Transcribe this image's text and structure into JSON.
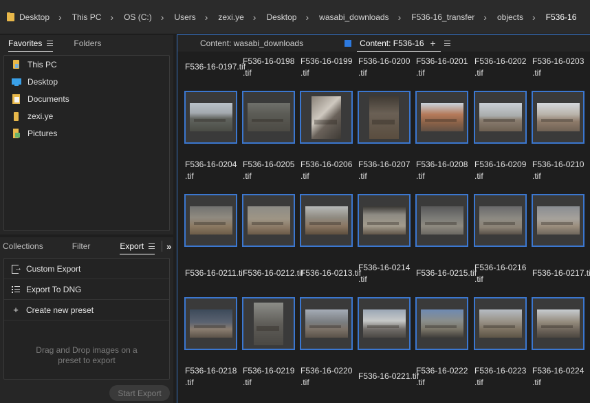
{
  "breadcrumb": [
    "Desktop",
    "This PC",
    "OS (C:)",
    "Users",
    "zexi.ye",
    "Desktop",
    "wasabi_downloads",
    "F536-16_transfer",
    "objects",
    "F536-16"
  ],
  "left_top": {
    "tabs": [
      "Favorites",
      "Folders"
    ],
    "favorites": [
      {
        "label": "This PC",
        "icon": "this-pc-icon"
      },
      {
        "label": "Desktop",
        "icon": "desktop-icon"
      },
      {
        "label": "Documents",
        "icon": "documents-icon"
      },
      {
        "label": "zexi.ye",
        "icon": "user-folder-icon"
      },
      {
        "label": "Pictures",
        "icon": "pictures-icon"
      }
    ]
  },
  "left_bottom": {
    "tabs": [
      "Collections",
      "Filter",
      "Export"
    ],
    "export_items": [
      {
        "label": "Custom Export",
        "icon": "export-icon"
      },
      {
        "label": "Export To DNG",
        "icon": "list-icon"
      },
      {
        "label": "Create new preset",
        "icon": "plus-icon"
      }
    ],
    "drag_hint": "Drag and Drop images on a preset to export",
    "start_export": "Start Export"
  },
  "content": {
    "tabs": [
      "Content: wasabi_downloads",
      "Content: F536-16"
    ],
    "colors": {
      "accent": "#3b77d0",
      "tab_color": "#2d7ae0"
    },
    "rows": [
      {
        "labels": [
          [
            "F536-16-0197.tif"
          ],
          [
            "F536-16-0198",
            ".tif"
          ],
          [
            "F536-16-0199",
            ".tif"
          ],
          [
            "F536-16-0200",
            ".tif"
          ],
          [
            "F536-16-0201",
            ".tif"
          ],
          [
            "F536-16-0202",
            ".tif"
          ],
          [
            "F536-16-0203",
            ".tif"
          ]
        ]
      },
      {
        "labels": [
          [
            "F536-16-0204",
            ".tif"
          ],
          [
            "F536-16-0205",
            ".tif"
          ],
          [
            "F536-16-0206",
            ".tif"
          ],
          [
            "F536-16-0207",
            ".tif"
          ],
          [
            "F536-16-0208",
            ".tif"
          ],
          [
            "F536-16-0209",
            ".tif"
          ],
          [
            "F536-16-0210",
            ".tif"
          ]
        ]
      },
      {
        "labels": [
          [
            "F536-16-0211.tif"
          ],
          [
            "F536-16-0212.tif"
          ],
          [
            "F536-16-0213.tif"
          ],
          [
            "F536-16-0214",
            ".tif"
          ],
          [
            "F536-16-0215.tif"
          ],
          [
            "F536-16-0216",
            ".tif"
          ],
          [
            "F536-16-0217.tif"
          ]
        ]
      },
      {
        "labels": [
          [
            "F536-16-0218",
            ".tif"
          ],
          [
            "F536-16-0219",
            ".tif"
          ],
          [
            "F536-16-0220",
            ".tif"
          ],
          [
            "F536-16-0221.tif"
          ],
          [
            "F536-16-0222",
            ".tif"
          ],
          [
            "F536-16-0223",
            ".tif"
          ],
          [
            "F536-16-0224",
            ".tif"
          ]
        ]
      }
    ]
  }
}
